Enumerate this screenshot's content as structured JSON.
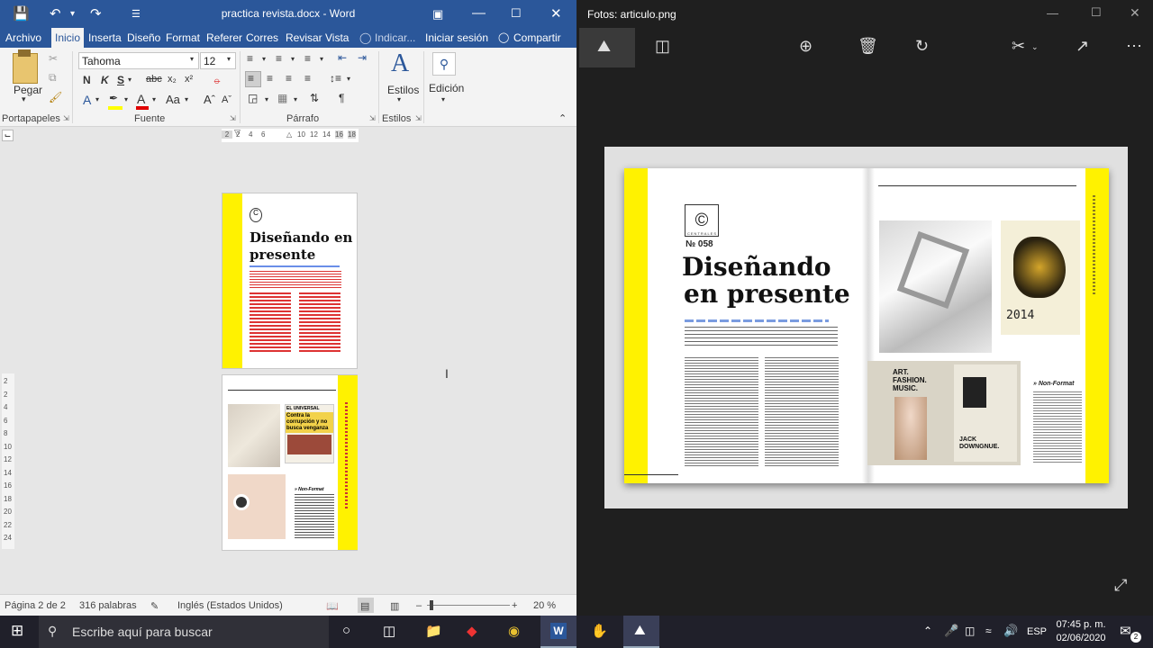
{
  "word": {
    "title": "practica revista.docx - Word",
    "tabs": [
      "Archivo",
      "Inicio",
      "Insertar",
      "Diseño",
      "Formato",
      "Referencias",
      "Correspondencia",
      "Revisar",
      "Vista"
    ],
    "tab_display": [
      "Archivo",
      "Inicio",
      "Inserta",
      "Diseño",
      "Format",
      "Referer",
      "Corres",
      "Revisar",
      "Vista"
    ],
    "tell_me": "Indicar...",
    "signin": "Iniciar sesión",
    "share": "Compartir",
    "ribbon": {
      "paste": "Pegar",
      "font_name": "Tahoma",
      "font_size": "12",
      "styles": "Estilos",
      "editing": "Edición",
      "groups": [
        "Portapapeles",
        "Fuente",
        "Párrafo",
        "Estilos"
      ]
    },
    "ruler_ticks": [
      "2",
      "2",
      "4",
      "6",
      "10",
      "12",
      "14",
      "16",
      "18"
    ],
    "vruler_ticks": [
      "2",
      "2",
      "4",
      "6",
      "8",
      "10",
      "12",
      "14",
      "16",
      "18",
      "20",
      "22",
      "24"
    ],
    "page1": {
      "heading": "Diseñando en presente"
    },
    "page2": {
      "headline": "Contra la corrupción y no busca venganza",
      "masthead": "EL UNIVERSAL",
      "caption": "» Non-Format"
    },
    "status": {
      "page": "Página 2 de 2",
      "words": "316 palabras",
      "language": "Inglés (Estados Unidos)",
      "zoom": "20 %"
    }
  },
  "photos": {
    "title": "Fotos: articulo.png",
    "magazine": {
      "logo_label": "CENTRALES",
      "issue": "№ 058",
      "heading_line1": "Diseñando",
      "heading_line2": "en presente",
      "side_caption": "» Non-Format",
      "poster1": "ART. FASHION. MUSIC.",
      "poster2": "JACK DOWNGNUE.",
      "year_text": "2014"
    }
  },
  "taskbar": {
    "search_placeholder": "Escribe aquí para buscar",
    "language": "ESP",
    "time": "07:45 p. m.",
    "date": "02/06/2020"
  },
  "colors": {
    "word_blue": "#2b579a",
    "accent_yellow": "#fff200",
    "dark": "#1f1f1f"
  }
}
